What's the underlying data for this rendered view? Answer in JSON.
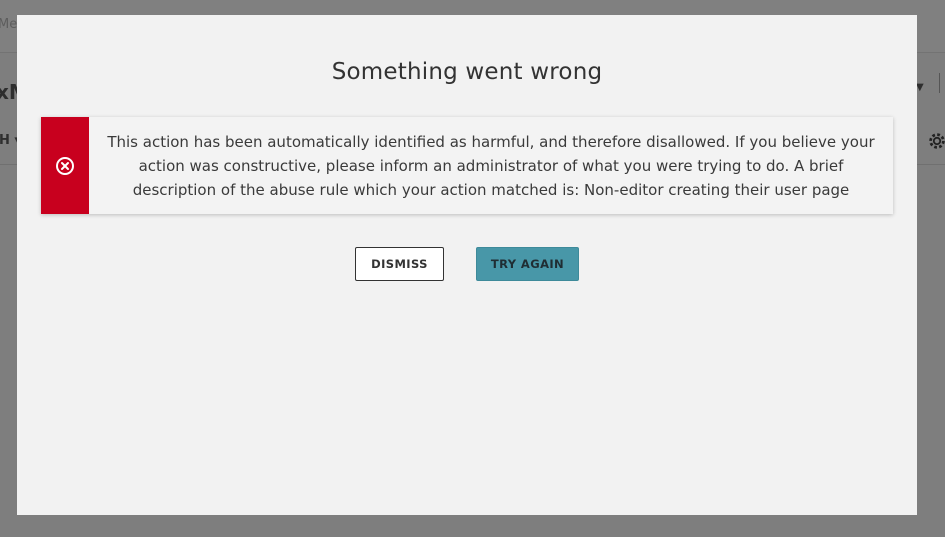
{
  "background": {
    "top_text_fragment": "Mes",
    "title_fragment": "xM",
    "nav_fragment": "H",
    "chevron_icon": "chevron-down-icon",
    "gear_icon": "gear-icon"
  },
  "modal": {
    "title": "Something went wrong",
    "error": {
      "icon": "error-circle-x-icon",
      "color": "#c8001e",
      "message": "This action has been automatically identified as harmful, and therefore disallowed. If you believe your action was constructive, please inform an administrator of what you were trying to do. A brief description of the abuse rule which your action matched is: Non-editor creating their user page"
    },
    "buttons": {
      "dismiss_label": "DISMISS",
      "try_again_label": "TRY AGAIN",
      "try_again_color": "#4897a8"
    }
  }
}
